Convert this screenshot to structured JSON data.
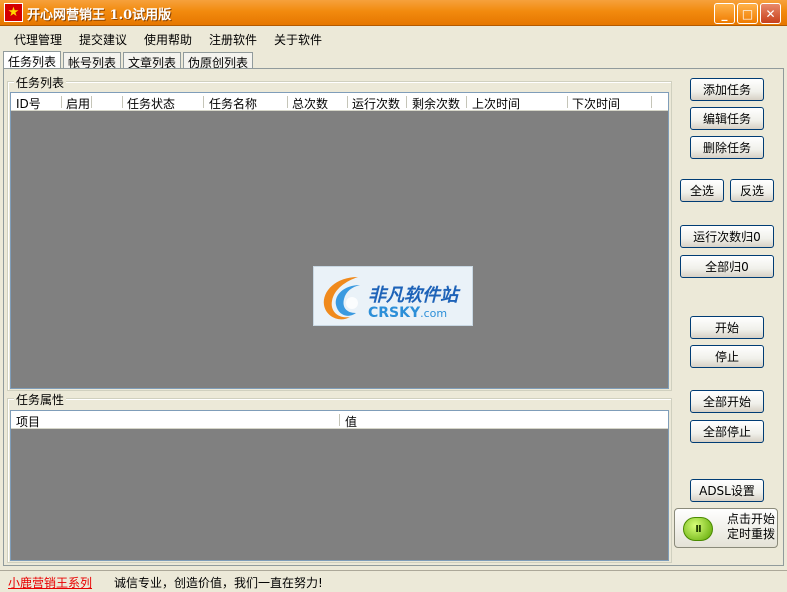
{
  "window": {
    "title": "开心网营销王 1.0试用版",
    "icon_glyph": "★",
    "minimize_glyph": "_",
    "maximize_glyph": "□",
    "close_glyph": "✕"
  },
  "menu": [
    "代理管理",
    "提交建议",
    "使用帮助",
    "注册软件",
    "关于软件"
  ],
  "tabs": [
    {
      "label": "任务列表",
      "active": true
    },
    {
      "label": "帐号列表",
      "active": false
    },
    {
      "label": "文章列表",
      "active": false
    },
    {
      "label": "伪原创列表",
      "active": false
    }
  ],
  "task_group": {
    "title": "任务列表",
    "columns": [
      "ID号",
      "启用",
      "任务状态",
      "任务名称",
      "总次数",
      "运行次数",
      "剩余次数",
      "上次时间",
      "下次时间"
    ]
  },
  "property_group": {
    "title": "任务属性",
    "columns": [
      "项目",
      "值"
    ]
  },
  "buttons": {
    "add_task": "添加任务",
    "edit_task": "编辑任务",
    "delete_task": "删除任务",
    "select_all": "全选",
    "invert_select": "反选",
    "reset_run_count": "运行次数归0",
    "reset_all": "全部归0",
    "start": "开始",
    "stop": "停止",
    "start_all": "全部开始",
    "stop_all": "全部停止",
    "adsl": "ADSL设置"
  },
  "big_button": {
    "icon": "pause-icon",
    "icon_glyph": "II",
    "line1": "点击开始",
    "line2": "定时重拨"
  },
  "watermark": {
    "cn": "非凡软件站",
    "en": "CRSKY",
    "en_suffix": ".com"
  },
  "status": {
    "link": "小鹿营销王系列",
    "message": "诚信专业，创造价值，我们一直在努力!"
  },
  "colors": {
    "titlebar": "#f28a0e",
    "list_bg": "#808080",
    "status_link": "#e80000"
  }
}
